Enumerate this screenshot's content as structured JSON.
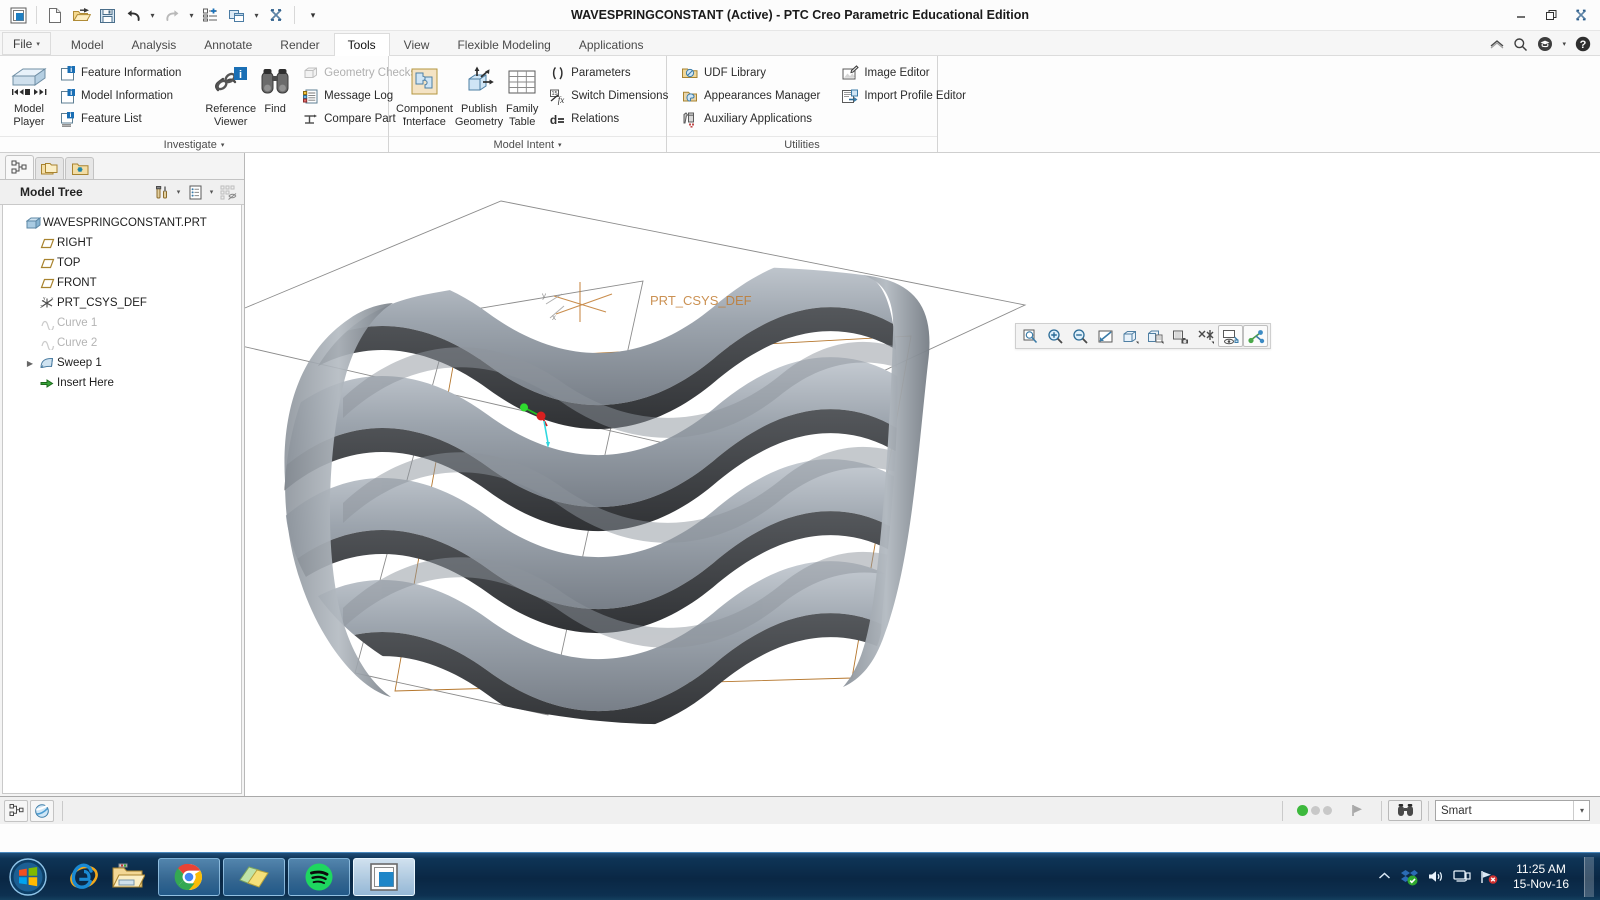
{
  "window": {
    "title": "WAVESPRINGCONSTANT (Active) - PTC Creo Parametric Educational Edition",
    "minimize_label": "–",
    "restore_label": "❐",
    "close_label": "✕"
  },
  "quick_access": {
    "items": [
      {
        "name": "creo-logo-icon",
        "label": "Creo"
      },
      {
        "name": "new-icon",
        "label": "New"
      },
      {
        "name": "open-icon",
        "label": "Open"
      },
      {
        "name": "save-icon",
        "label": "Save"
      },
      {
        "name": "undo-icon",
        "label": "Undo"
      },
      {
        "name": "redo-icon",
        "label": "Redo"
      },
      {
        "name": "regenerate-icon",
        "label": "Regenerate"
      },
      {
        "name": "window-switch-icon",
        "label": "Close Window"
      },
      {
        "name": "close-window-icon",
        "label": "Close"
      }
    ],
    "overflow_label": "▾"
  },
  "ribbon": {
    "file_tab": "File",
    "tabs": [
      {
        "label": "Model",
        "active": false
      },
      {
        "label": "Analysis",
        "active": false
      },
      {
        "label": "Annotate",
        "active": false
      },
      {
        "label": "Render",
        "active": false
      },
      {
        "label": "Tools",
        "active": true
      },
      {
        "label": "View",
        "active": false
      },
      {
        "label": "Flexible Modeling",
        "active": false
      },
      {
        "label": "Applications",
        "active": false
      }
    ],
    "right_icons": [
      {
        "name": "collapse-ribbon-icon",
        "label": "^"
      },
      {
        "name": "search-icon",
        "label": "Search"
      },
      {
        "name": "graduation-cap-icon",
        "label": "Learning"
      },
      {
        "name": "help-icon",
        "label": "Help"
      }
    ],
    "groups": [
      {
        "title": "Investigate",
        "big_buttons": [
          {
            "name": "model-player-button",
            "label": "Model\nPlayer",
            "line1": "Model",
            "line2": "Player"
          }
        ],
        "small_buttons_1": [
          {
            "name": "feature-information-button",
            "label": "Feature Information",
            "disabled": false
          },
          {
            "name": "model-information-button",
            "label": "Model Information",
            "disabled": false
          },
          {
            "name": "feature-list-button",
            "label": "Feature List",
            "disabled": false
          }
        ],
        "big_buttons_2": [
          {
            "name": "reference-viewer-button",
            "line1": "Reference",
            "line2": "Viewer"
          },
          {
            "name": "find-button",
            "line1": "Find",
            "line2": ""
          }
        ],
        "small_buttons_2": [
          {
            "name": "geometry-checks-button",
            "label": "Geometry Checks",
            "disabled": true
          },
          {
            "name": "message-log-button",
            "label": "Message Log",
            "disabled": false
          },
          {
            "name": "compare-part-button",
            "label": "Compare Part",
            "disabled": false,
            "has_caret": true
          }
        ]
      },
      {
        "title": "Model Intent",
        "big_buttons": [
          {
            "name": "component-interface-button",
            "line1": "Component",
            "line2": "Interface"
          },
          {
            "name": "publish-geometry-button",
            "line1": "Publish",
            "line2": "Geometry"
          },
          {
            "name": "family-table-button",
            "line1": "Family",
            "line2": "Table"
          }
        ],
        "small_buttons": [
          {
            "name": "parameters-button",
            "label": "Parameters",
            "disabled": false
          },
          {
            "name": "switch-dimensions-button",
            "label": "Switch Dimensions",
            "disabled": false
          },
          {
            "name": "relations-button",
            "label": "Relations",
            "disabled": false
          }
        ]
      },
      {
        "title": "Utilities",
        "small_buttons_left": [
          {
            "name": "udf-library-button",
            "label": "UDF Library",
            "disabled": false
          },
          {
            "name": "appearances-manager-button",
            "label": "Appearances Manager",
            "disabled": false
          },
          {
            "name": "auxiliary-applications-button",
            "label": "Auxiliary Applications",
            "disabled": false
          }
        ],
        "small_buttons_right": [
          {
            "name": "image-editor-button",
            "label": "Image Editor",
            "disabled": false
          },
          {
            "name": "import-profile-editor-button",
            "label": "Import Profile Editor",
            "disabled": false
          }
        ]
      }
    ]
  },
  "sidebar": {
    "nav_tabs": [
      {
        "name": "model-tree-tab",
        "label": "Model Tree",
        "active": true
      },
      {
        "name": "folder-browser-tab",
        "label": "Folder Browser",
        "active": false
      },
      {
        "name": "favorites-tab",
        "label": "Favorites",
        "active": false
      }
    ],
    "panel_title": "Model Tree",
    "tools": [
      {
        "name": "settings-tools-icon",
        "label": "Settings"
      },
      {
        "name": "display-filters-icon",
        "label": "Display"
      },
      {
        "name": "tree-filters-icon",
        "label": "Tree Filters"
      }
    ],
    "tree": [
      {
        "label": "WAVESPRINGCONSTANT.PRT",
        "icon": "part-icon",
        "level": 0,
        "dim": false,
        "expandable": false
      },
      {
        "label": "RIGHT",
        "icon": "datum-plane-icon",
        "level": 1,
        "dim": false,
        "expandable": false
      },
      {
        "label": "TOP",
        "icon": "datum-plane-icon",
        "level": 1,
        "dim": false,
        "expandable": false
      },
      {
        "label": "FRONT",
        "icon": "datum-plane-icon",
        "level": 1,
        "dim": false,
        "expandable": false
      },
      {
        "label": "PRT_CSYS_DEF",
        "icon": "coordinate-system-icon",
        "level": 1,
        "dim": false,
        "expandable": false
      },
      {
        "label": "Curve 1",
        "icon": "curve-icon",
        "level": 1,
        "dim": true,
        "expandable": false
      },
      {
        "label": "Curve 2",
        "icon": "curve-icon",
        "level": 1,
        "dim": true,
        "expandable": false
      },
      {
        "label": "Sweep 1",
        "icon": "sweep-icon",
        "level": 1,
        "dim": false,
        "expandable": true
      },
      {
        "label": "Insert Here",
        "icon": "insert-here-icon",
        "level": 1,
        "dim": false,
        "expandable": false
      }
    ]
  },
  "graphics": {
    "csys_label": "PRT_CSYS_DEF",
    "model_name": "wave-spring",
    "toolbar": [
      {
        "name": "refit-icon",
        "label": "Refit"
      },
      {
        "name": "zoom-in-icon",
        "label": "Zoom In"
      },
      {
        "name": "zoom-out-icon",
        "label": "Zoom Out"
      },
      {
        "name": "repaint-icon",
        "label": "Repaint"
      },
      {
        "name": "display-style-icon",
        "label": "Display Style"
      },
      {
        "name": "saved-orientations-icon",
        "label": "Saved Orientations"
      },
      {
        "name": "view-manager-icon",
        "label": "View Manager"
      },
      {
        "name": "datum-display-filters-icon",
        "label": "Datum Display Filters"
      },
      {
        "name": "annotation-display-icon",
        "label": "Annotation Display"
      },
      {
        "name": "spin-center-icon",
        "label": "Spin Center"
      }
    ],
    "colors": {
      "model_light": "#b7bdc4",
      "model_dark": "#45474a",
      "datum_outline": "#b5762c",
      "csys_text": "#c07a2e",
      "axis_x": "#d02020",
      "axis_y": "#20c020",
      "axis_z": "#30d8e0"
    }
  },
  "status_bar": {
    "left_buttons": [
      {
        "name": "model-tree-toggle-button",
        "label": "Model Tree"
      },
      {
        "name": "web-browser-toggle-button",
        "label": "Browser"
      }
    ],
    "dots_label": "Regeneration status",
    "play_label": "▶",
    "find_label": "Search",
    "filter_value": "Smart",
    "filter_caret": "▾"
  },
  "taskbar": {
    "start_label": "Start",
    "quick_launch": [
      {
        "name": "internet-explorer-icon",
        "label": "Internet Explorer"
      },
      {
        "name": "windows-explorer-icon",
        "label": "Windows Explorer"
      }
    ],
    "apps": [
      {
        "name": "google-chrome-taskbar-item",
        "label": "Google Chrome",
        "active": false
      },
      {
        "name": "sticky-notes-taskbar-item",
        "label": "Sticky Notes",
        "active": false
      },
      {
        "name": "spotify-taskbar-item",
        "label": "Spotify",
        "active": false
      },
      {
        "name": "creo-parametric-taskbar-item",
        "label": "PTC Creo Parametric",
        "active": true
      }
    ],
    "tray": [
      {
        "name": "show-hidden-icons-button",
        "label": "▲"
      },
      {
        "name": "dropbox-tray-icon",
        "label": "Dropbox"
      },
      {
        "name": "volume-tray-icon",
        "label": "Volume"
      },
      {
        "name": "network-tray-icon",
        "label": "Network"
      },
      {
        "name": "action-center-tray-icon",
        "label": "Action Center"
      }
    ],
    "clock_time": "11:25 AM",
    "clock_date": "15-Nov-16"
  }
}
